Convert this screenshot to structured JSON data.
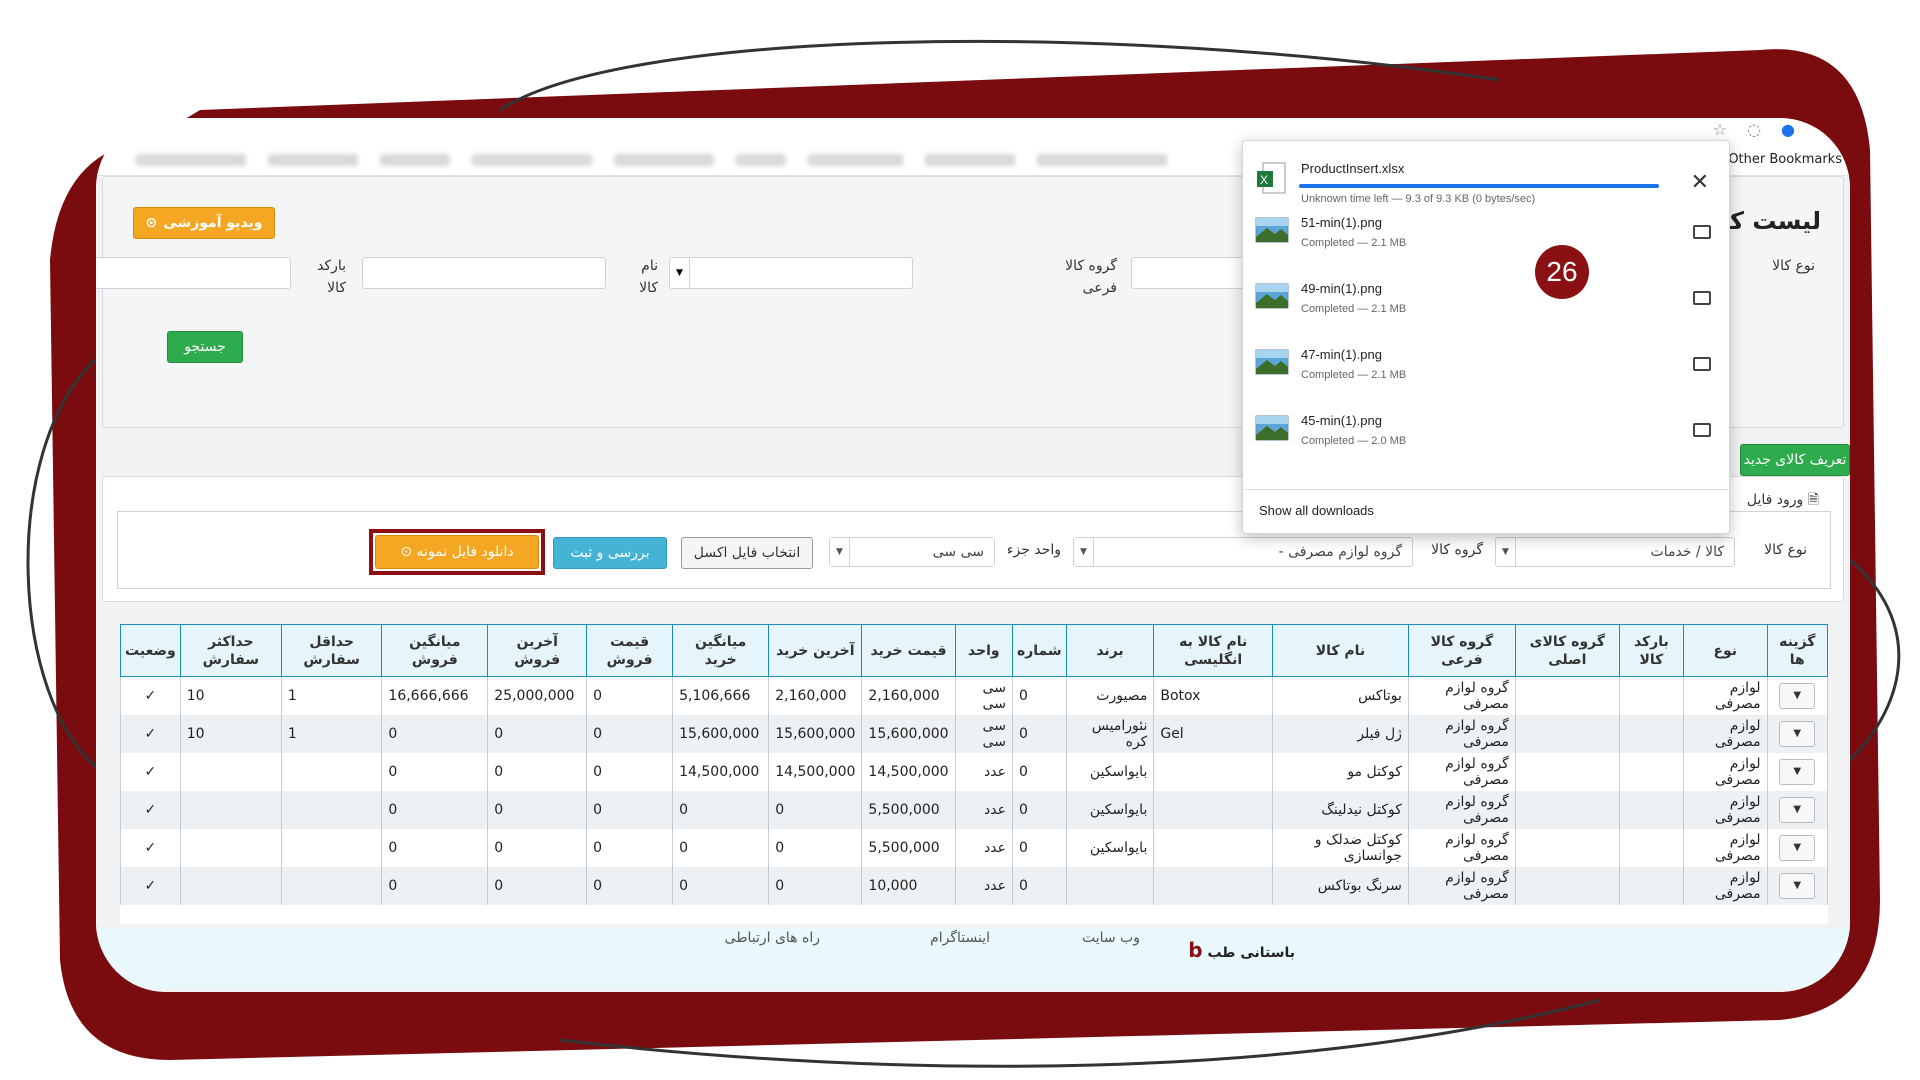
{
  "browser": {
    "other_bookmarks": "Other Bookmarks"
  },
  "page": {
    "title": "لیست کالا",
    "video_button": "ویدیو آموزشی",
    "search": {
      "product_type_label": "نوع کالا",
      "group_label": "گروه کالا فرعی",
      "name_label": "نام کالا",
      "barcode_label": "بارکد کالا",
      "search_button": "جستجو"
    },
    "define_button": "تعریف کالای جدید",
    "import": {
      "section_label": "ورود فایل",
      "type_label": "نوع کالا",
      "type_value": "کالا / خدمات",
      "group_label": "گروه کالا",
      "group_value": "گروه لوازم مصرفی -",
      "unit_label": "واحد جزء",
      "unit_value": "سی سی",
      "choose_excel": "انتخاب فایل اکسل",
      "review_button": "بررسی و ثبت",
      "download_sample": "دانلود فایل نمونه"
    },
    "table": {
      "headers": [
        "گزینه ها",
        "نوع",
        "بارکد کالا",
        "گروه کالای اصلی",
        "گروه کالا فرعی",
        "نام کالا",
        "نام کالا به انگلیسی",
        "برند",
        "شماره",
        "واحد",
        "قیمت خرید",
        "آخرین خرید",
        "میانگین خرید",
        "قیمت فروش",
        "آخرین فروش",
        "میانگین فروش",
        "حداقل سفارش",
        "حداکثر سفارش",
        "وضعیت"
      ],
      "rows": [
        {
          "type": "لوازم مصرفی",
          "barcode": "",
          "main_group": "",
          "sub_group": "گروه لوازم مصرفی",
          "name": "بوتاکس",
          "name_en": "Botox",
          "brand": "مصیورت",
          "number": "0",
          "unit": "سی سی",
          "buy_price": "2,160,000",
          "last_buy": "2,160,000",
          "avg_buy": "5,106,666",
          "sell_price": "0",
          "last_sell": "25,000,000",
          "avg_sell": "16,666,666",
          "min_order": "1",
          "max_order": "10",
          "status": "✓"
        },
        {
          "type": "لوازم مصرفی",
          "barcode": "",
          "main_group": "",
          "sub_group": "گروه لوازم مصرفی",
          "name": "ژل فیلر",
          "name_en": "Gel",
          "brand": "نئورامیس کره",
          "number": "0",
          "unit": "سی سی",
          "buy_price": "15,600,000",
          "last_buy": "15,600,000",
          "avg_buy": "15,600,000",
          "sell_price": "0",
          "last_sell": "0",
          "avg_sell": "0",
          "min_order": "1",
          "max_order": "10",
          "status": "✓"
        },
        {
          "type": "لوازم مصرفی",
          "barcode": "",
          "main_group": "",
          "sub_group": "گروه لوازم مصرفی",
          "name": "کوکتل مو",
          "name_en": "",
          "brand": "بایواسکین",
          "number": "0",
          "unit": "عدد",
          "buy_price": "14,500,000",
          "last_buy": "14,500,000",
          "avg_buy": "14,500,000",
          "sell_price": "0",
          "last_sell": "0",
          "avg_sell": "0",
          "min_order": "",
          "max_order": "",
          "status": "✓"
        },
        {
          "type": "لوازم مصرفی",
          "barcode": "",
          "main_group": "",
          "sub_group": "گروه لوازم مصرفی",
          "name": "کوکتل نیدلینگ",
          "name_en": "",
          "brand": "بایواسکین",
          "number": "0",
          "unit": "عدد",
          "buy_price": "5,500,000",
          "last_buy": "0",
          "avg_buy": "0",
          "sell_price": "0",
          "last_sell": "0",
          "avg_sell": "0",
          "min_order": "",
          "max_order": "",
          "status": "✓"
        },
        {
          "type": "لوازم مصرفی",
          "barcode": "",
          "main_group": "",
          "sub_group": "گروه لوازم مصرفی",
          "name": "کوکتل ضدلک و جوانسازی",
          "name_en": "",
          "brand": "بایواسکین",
          "number": "0",
          "unit": "عدد",
          "buy_price": "5,500,000",
          "last_buy": "0",
          "avg_buy": "0",
          "sell_price": "0",
          "last_sell": "0",
          "avg_sell": "0",
          "min_order": "",
          "max_order": "",
          "status": "✓"
        },
        {
          "type": "لوازم مصرفی",
          "barcode": "",
          "main_group": "",
          "sub_group": "گروه لوازم مصرفی",
          "name": "سرنگ بوتاکس",
          "name_en": "",
          "brand": "",
          "number": "0",
          "unit": "عدد",
          "buy_price": "10,000",
          "last_buy": "0",
          "avg_buy": "0",
          "sell_price": "0",
          "last_sell": "0",
          "avg_sell": "0",
          "min_order": "",
          "max_order": "",
          "status": "✓"
        }
      ]
    },
    "footer": {
      "brand": "باستانی طب",
      "website_label": "وب سایت",
      "instagram_label": "اینستاگرام",
      "contact_label": "راه های ارتباطی"
    }
  },
  "downloads": {
    "items": [
      {
        "name": "ProductInsert.xlsx",
        "status": "Unknown time left — 9.3 of 9.3 KB (0 bytes/sec)",
        "kind": "excel"
      },
      {
        "name": "51-min(1).png",
        "status": "Completed — 2.1 MB",
        "kind": "image"
      },
      {
        "name": "49-min(1).png",
        "status": "Completed — 2.1 MB",
        "kind": "image"
      },
      {
        "name": "47-min(1).png",
        "status": "Completed — 2.1 MB",
        "kind": "image"
      },
      {
        "name": "45-min(1).png",
        "status": "Completed — 2.0 MB",
        "kind": "image"
      }
    ],
    "show_all": "Show all downloads",
    "progress": 1.0
  },
  "step_badge": "26",
  "colors": {
    "frame": "#7a0c10",
    "accent_orange": "#f5a623",
    "accent_green": "#2eab4c",
    "accent_blue": "#45b3d6",
    "table_border": "#1b8bb8"
  }
}
